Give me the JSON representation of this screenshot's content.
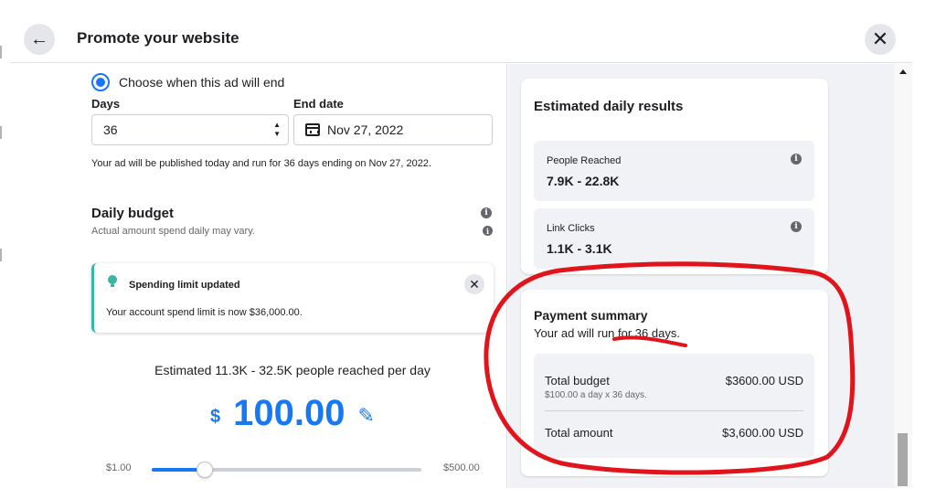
{
  "header": {
    "title": "Promote your website",
    "back_icon": "arrow-left-icon",
    "close_icon": "close-icon"
  },
  "schedule": {
    "radio_label": "Choose when this ad will end",
    "days_label": "Days",
    "days_value": "36",
    "end_date_label": "End date",
    "end_date_value": "Nov 27, 2022",
    "publish_note": "Your ad will be published today and run for 36 days ending on Nov 27, 2022."
  },
  "budget": {
    "title": "Daily budget",
    "subtitle": "Actual amount spend daily may vary.",
    "notice_title": "Spending limit updated",
    "notice_text": "Your account spend limit is now $36,000.00.",
    "estimate": "Estimated 11.3K - 32.5K people reached per day",
    "currency_symbol": "$",
    "amount": "100.00",
    "slider_min": "$1.00",
    "slider_max": "$500.00",
    "slider_fraction": 0.198
  },
  "results": {
    "title": "Estimated daily results",
    "metrics": [
      {
        "label": "People Reached",
        "value": "7.9K - 22.8K"
      },
      {
        "label": "Link Clicks",
        "value": "1.1K - 3.1K"
      }
    ]
  },
  "payment": {
    "title": "Payment summary",
    "subtitle": "Your ad will run for 36 days.",
    "total_budget_label": "Total budget",
    "total_budget_value": "$3600.00 USD",
    "total_budget_note": "$100.00 a day x 36 days.",
    "total_amount_label": "Total amount",
    "total_amount_value": "$3,600.00 USD"
  },
  "colors": {
    "accent": "#1877f2",
    "notice_accent": "#3ab5a3",
    "annotation": "#e0151b",
    "panel_bg": "#f0f2f5"
  }
}
